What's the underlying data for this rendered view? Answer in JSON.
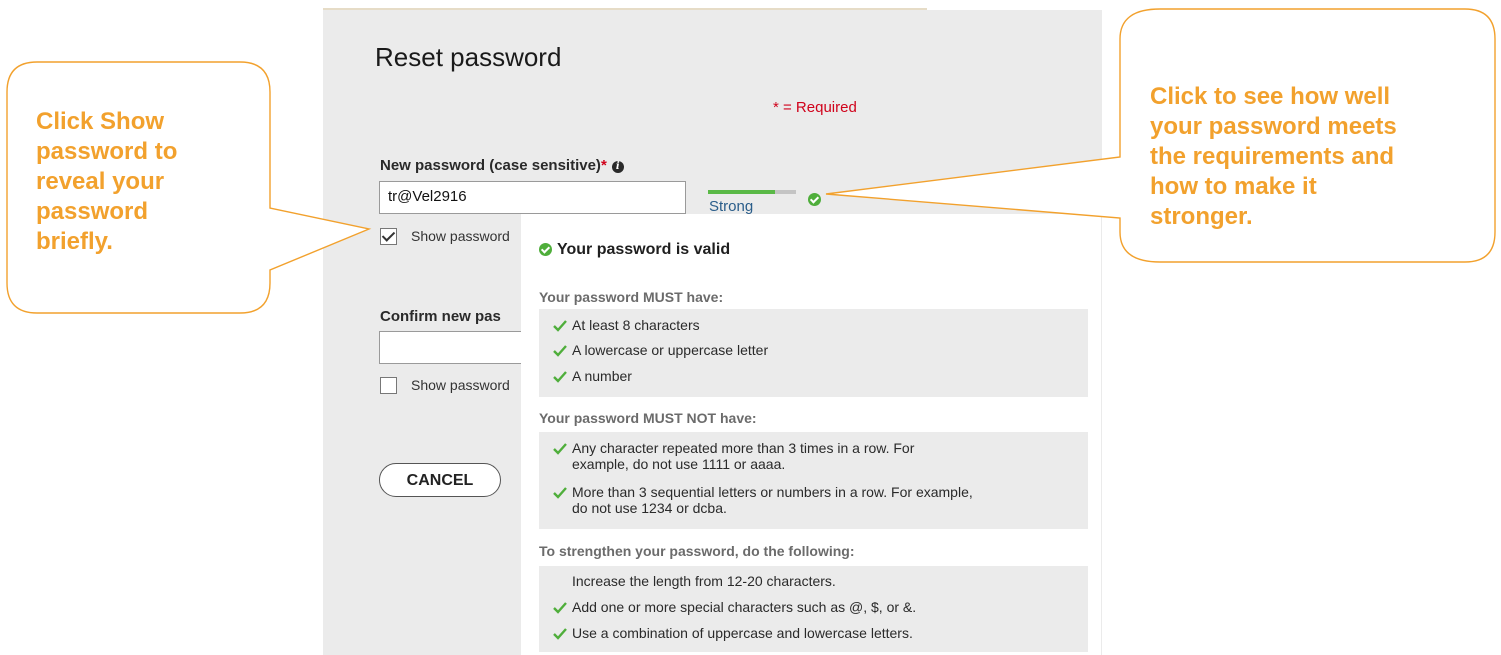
{
  "form": {
    "title": "Reset password",
    "required_note": "* = Required",
    "new_password_label": "New password (case sensitive)",
    "required_star": "*",
    "new_password_value": "tr@Vel2916",
    "show_password_label": "Show password",
    "show_password_checked": true,
    "confirm_password_label": "Confirm new pas",
    "confirm_password_value": "",
    "confirm_show_password_label": "Show password",
    "confirm_show_password_checked": false,
    "cancel_label": "CANCEL"
  },
  "strength": {
    "label": "Strong",
    "fill_fraction": 0.76,
    "fill_color": "#5ab947",
    "status": "valid"
  },
  "popover": {
    "title": "Your password is valid",
    "sections": [
      {
        "heading": "Your password MUST have:",
        "items": [
          {
            "text": "At least 8 characters",
            "ok": true
          },
          {
            "text": "A lowercase or uppercase letter",
            "ok": true
          },
          {
            "text": "A number",
            "ok": true
          }
        ]
      },
      {
        "heading": "Your password MUST NOT have:",
        "items": [
          {
            "line1": "Any character repeated more than 3 times in a row. For",
            "line2": "example, do not use 1111 or aaaa.",
            "ok": true
          },
          {
            "line1": "More than 3 sequential letters or numbers in a row. For example,",
            "line2": "do not use 1234 or dcba.",
            "ok": true
          }
        ]
      },
      {
        "heading": "To strengthen your password, do the following:",
        "items": [
          {
            "text": "Increase the length from 12-20 characters.",
            "ok": false
          },
          {
            "text": "Add one or more special characters such as @, $, or &.",
            "ok": true
          },
          {
            "text": "Use a combination of uppercase and lowercase letters.",
            "ok": true
          }
        ]
      }
    ]
  },
  "callouts": {
    "left": [
      "Click Show",
      "password to",
      "reveal your",
      "password",
      "briefly."
    ],
    "right": [
      "Click to see how well",
      "your password meets",
      "the requirements and",
      "how to make it",
      "stronger."
    ],
    "color": "#f2a12d"
  },
  "colors": {
    "accent_orange": "#f2a12d",
    "required_red": "#d0021b",
    "success_green": "#4fae3b",
    "panel_gray": "#ebebeb"
  }
}
